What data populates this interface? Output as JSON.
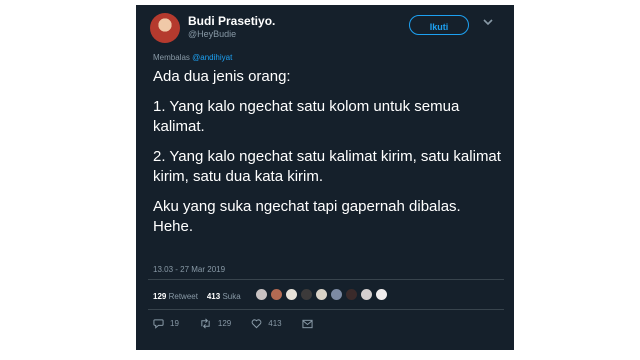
{
  "user": {
    "display_name": "Budi Prasetiyo.",
    "handle": "@HeyBudie"
  },
  "follow_button": {
    "label": "Ikuti"
  },
  "replying": {
    "prefix": "Membalas",
    "mention": "@andihiyat"
  },
  "tweet": {
    "paragraphs": [
      "Ada dua jenis orang:",
      "1. Yang kalo ngechat satu kolom untuk semua kalimat.",
      "2. Yang kalo ngechat satu kalimat kirim, satu kalimat kirim, satu dua kata kirim.",
      "Aku yang suka ngechat tapi gapernah dibalas. Hehe."
    ],
    "timestamp": "13.03 - 27 Mar 2019"
  },
  "stats": {
    "retweet_count": "129",
    "retweet_label": "Retweet",
    "like_count": "413",
    "like_label": "Suka"
  },
  "liker_avatars": [
    {
      "icon": "avatar-1",
      "color": "#c9c2c2"
    },
    {
      "icon": "avatar-2",
      "color": "#b36a52"
    },
    {
      "icon": "avatar-3",
      "color": "#e7e1d8"
    },
    {
      "icon": "avatar-4",
      "color": "#3c3a3a"
    },
    {
      "icon": "avatar-5",
      "color": "#d9d2c7"
    },
    {
      "icon": "avatar-6",
      "color": "#7c8aa3"
    },
    {
      "icon": "avatar-7",
      "color": "#3a2a2a"
    },
    {
      "icon": "avatar-8",
      "color": "#d4cfcf"
    },
    {
      "icon": "avatar-9",
      "color": "#f1eded"
    }
  ],
  "actions": {
    "reply_count": "19",
    "retweet_count": "129",
    "like_count": "413"
  },
  "colors": {
    "background": "#15202b",
    "accent": "#1da1f2",
    "muted": "#8899a6"
  }
}
